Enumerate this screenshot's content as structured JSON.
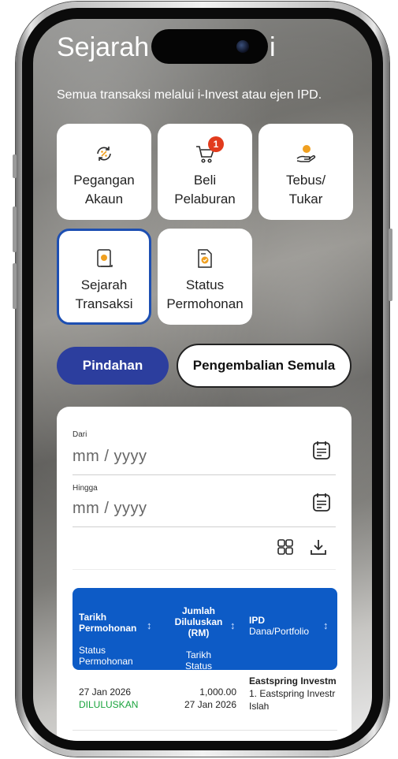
{
  "page": {
    "title": "Sejarah",
    "title_tail": "i",
    "subtitle": "Semua transaksi melalui i-Invest atau ejen IPD."
  },
  "tiles": [
    {
      "label": "Pegangan\nAkaun",
      "icon": "exchange-percent-icon"
    },
    {
      "label": "Beli\nPelaburan",
      "icon": "cart-icon",
      "badge": "1"
    },
    {
      "label": "Tebus/\nTukar",
      "icon": "hand-coin-icon"
    },
    {
      "label": "Sejarah\nTransaksi",
      "icon": "scroll-icon",
      "active": true
    },
    {
      "label": "Status\nPermohonan",
      "icon": "document-check-icon"
    }
  ],
  "tabs": {
    "active": "Pindahan",
    "inactive": "Pengembalian Semula"
  },
  "form": {
    "from_label": "Dari",
    "from_placeholder": "mm / yyyy",
    "to_label": "Hingga",
    "to_placeholder": "mm / yyyy"
  },
  "table": {
    "headers": {
      "col1_bold": "Tarikh\nPermohonan",
      "col1_normal": "Status\nPermohonan",
      "col2_bold": "Jumlah\nDiluluskan\n(RM)",
      "col2_normal": "Tarikh\nStatus",
      "col3_bold": "IPD",
      "col3_normal": "Dana/Portfolio"
    },
    "rows": [
      {
        "date": "27 Jan 2026",
        "status": "DILULUSKAN",
        "amount": "1,000.00",
        "status_date": "27 Jan 2026",
        "ipd": "Eastspring Investm",
        "fund": "1. Eastspring Investr",
        "fund2": "Islah"
      }
    ]
  },
  "colors": {
    "accent": "#2c3e9e",
    "table_header": "#0d5bc6",
    "status_approved": "#17a33b",
    "badge": "#e23b1d"
  }
}
